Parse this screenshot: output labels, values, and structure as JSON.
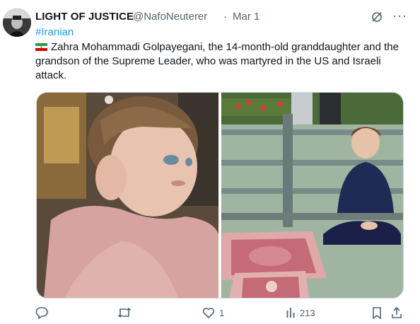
{
  "post": {
    "author_name": "LIGHT OF JUSTICE",
    "author_handle": "@NafoNeuterer",
    "separator": "·",
    "date": "Mar 1",
    "hashtag": "#Iranian",
    "flag": "iran-flag",
    "body": "Zahra Mohammadi Golpayegani, the 14-month-old granddaughter and the grandson of the Supreme Leader, who was martyred in the US and Israeli attack."
  },
  "media": {
    "images": [
      "toddler-girl-photo",
      "boy-seated-on-rug-photo"
    ]
  },
  "actions": {
    "reply": "",
    "repost": "",
    "likes": "1",
    "views": "213"
  },
  "colors": {
    "accent": "#1d9bf0",
    "secondary_text": "#536471",
    "border": "#cfd9de"
  },
  "icons": [
    "avatar-image",
    "grok-icon",
    "more-icon",
    "reply-icon",
    "repost-icon",
    "like-icon",
    "views-icon",
    "bookmark-icon",
    "share-icon"
  ]
}
